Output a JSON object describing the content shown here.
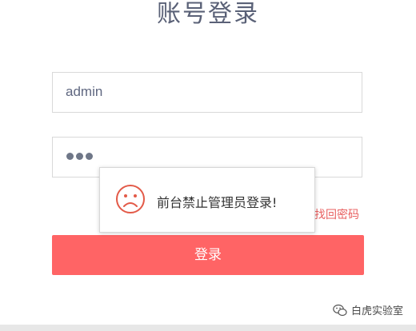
{
  "page": {
    "title": "账号登录"
  },
  "form": {
    "username_value": "admin",
    "password_masked_length": 3,
    "forgot_password_label": "找回密码",
    "login_button_label": "登录"
  },
  "toast": {
    "icon": "sad-face-icon",
    "message": "前台禁止管理员登录!"
  },
  "watermark": {
    "icon": "wechat-icon",
    "text": "白虎实验室"
  },
  "colors": {
    "primary": "#ff6465",
    "title": "#5a6177",
    "link": "#e86060"
  }
}
